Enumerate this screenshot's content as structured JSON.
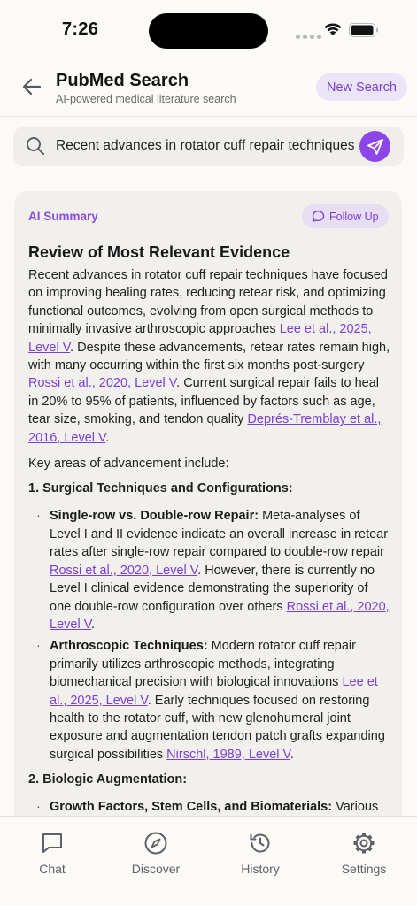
{
  "status": {
    "time": "7:26"
  },
  "header": {
    "title": "PubMed Search",
    "subtitle": "AI-powered medical literature search",
    "new_search": "New Search"
  },
  "search": {
    "query": "Recent advances in rotator cuff repair techniques"
  },
  "card": {
    "label": "AI Summary",
    "follow_up": "Follow Up",
    "heading": "Review of Most Relevant Evidence",
    "intro": {
      "t1": "Recent advances in rotator cuff repair techniques have focused on improving healing rates, reducing retear risk, and optimizing functional outcomes, evolving from open surgical methods to minimally invasive arthroscopic approaches ",
      "c1": "Lee et al., 2025, Level V",
      "t2": ". Despite these advancements, retear rates remain high, with many occurring within the first six months post-surgery ",
      "c2": "Rossi et al., 2020, Level V",
      "t3": ". Current surgical repair fails to heal in 20% to 95% of patients, influenced by factors such as age, tear size, smoking, and tendon quality ",
      "c3": "Deprés-Tremblay et al., 2016, Level V",
      "t4": "."
    },
    "key_areas": "Key areas of advancement include:",
    "section1": "1. Surgical Techniques and Configurations:",
    "b1": {
      "title": "Single-row vs. Double-row Repair:",
      "t1": " Meta-analyses of Level I and II evidence indicate an overall increase in retear rates after single-row repair compared to double-row repair ",
      "c1": "Rossi et al., 2020, Level V",
      "t2": ". However, there is currently no Level I clinical evidence demonstrating the superiority of one double-row configuration over others ",
      "c2": "Rossi et al., 2020, Level V",
      "t3": "."
    },
    "b2": {
      "title": "Arthroscopic Techniques:",
      "t1": " Modern rotator cuff repair primarily utilizes arthroscopic methods, integrating biomechanical precision with biological innovations ",
      "c1": "Lee et al., 2025, Level V",
      "t2": ". Early techniques focused on restoring health to the rotator cuff, with new glenohumeral joint exposure and augmentation tendon patch grafts expanding surgical possibilities ",
      "c2": "Nirschl, 1989, Level V",
      "t3": "."
    },
    "section2": "2. Biologic Augmentation:",
    "b3": {
      "title": "Growth Factors, Stem Cells, and Biomaterials:",
      "t1": " Various"
    }
  },
  "tabs": [
    {
      "label": "Chat",
      "icon": "chat-icon"
    },
    {
      "label": "Discover",
      "icon": "compass-icon"
    },
    {
      "label": "History",
      "icon": "history-icon"
    },
    {
      "label": "Settings",
      "icon": "gear-icon"
    }
  ],
  "colors": {
    "accent": "#8b45e8",
    "link": "#7a3fd6",
    "card_bg": "#f1f0ec"
  }
}
